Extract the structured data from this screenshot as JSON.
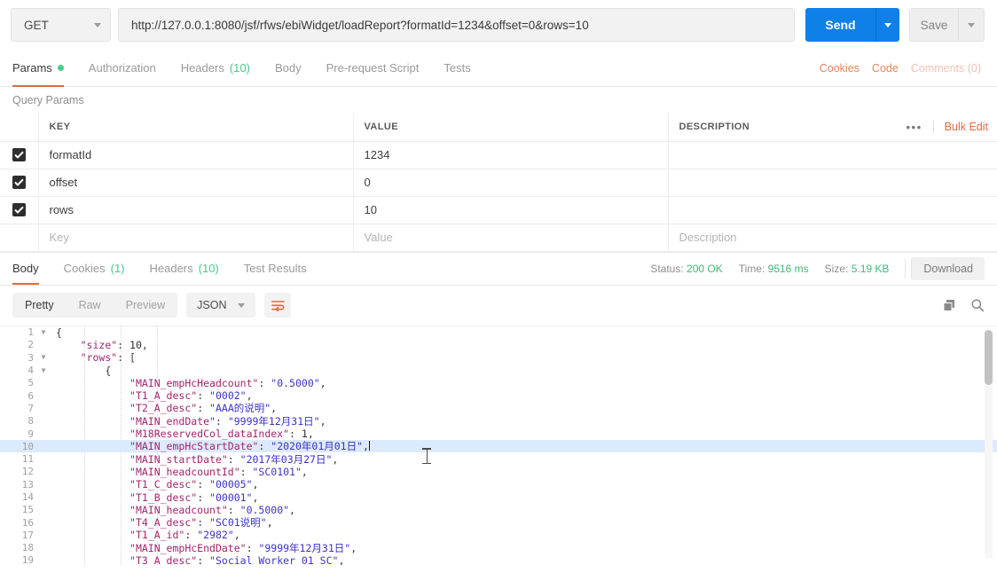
{
  "request_bar": {
    "method": "GET",
    "url": "http://127.0.0.1:8080/jsf/rfws/ebiWidget/loadReport?formatId=1234&offset=0&rows=10",
    "send_label": "Send",
    "save_label": "Save"
  },
  "request_tabs": {
    "items": [
      {
        "label": "Params",
        "active": true,
        "dot": true
      },
      {
        "label": "Authorization",
        "active": false
      },
      {
        "label": "Headers",
        "count": "(10)",
        "active": false
      },
      {
        "label": "Body",
        "active": false
      },
      {
        "label": "Pre-request Script",
        "active": false
      },
      {
        "label": "Tests",
        "active": false
      }
    ],
    "right_links": [
      {
        "label": "Cookies",
        "muted": false
      },
      {
        "label": "Code",
        "muted": false
      },
      {
        "label": "Comments (0)",
        "muted": true
      }
    ]
  },
  "query_params": {
    "section_label": "Query Params",
    "headers": {
      "key": "KEY",
      "value": "VALUE",
      "description": "DESCRIPTION"
    },
    "more_label": "•••",
    "bulk_edit_label": "Bulk Edit",
    "rows": [
      {
        "checked": true,
        "key": "formatId",
        "value": "1234",
        "description": ""
      },
      {
        "checked": true,
        "key": "offset",
        "value": "0",
        "description": ""
      },
      {
        "checked": true,
        "key": "rows",
        "value": "10",
        "description": ""
      }
    ],
    "placeholder_row": {
      "key": "Key",
      "value": "Value",
      "description": "Description"
    }
  },
  "response_tabs": {
    "items": [
      {
        "label": "Body",
        "active": true
      },
      {
        "label": "Cookies",
        "count": "(1)",
        "active": false
      },
      {
        "label": "Headers",
        "count": "(10)",
        "active": false
      },
      {
        "label": "Test Results",
        "active": false
      }
    ],
    "status_label": "Status:",
    "status_value": "200 OK",
    "time_label": "Time:",
    "time_value": "9516 ms",
    "size_label": "Size:",
    "size_value": "5.19 KB",
    "download_label": "Download"
  },
  "body_toolbar": {
    "views": [
      {
        "label": "Pretty",
        "active": true
      },
      {
        "label": "Raw",
        "active": false
      },
      {
        "label": "Preview",
        "active": false
      }
    ],
    "format": "JSON",
    "wrap_icon": "word-wrap-icon",
    "copy_icon": "copy-icon",
    "search_icon": "search-icon"
  },
  "colors": {
    "accent_orange": "#e8673c",
    "send_blue": "#0f80e8",
    "status_green": "#40b877",
    "json_key": "#a3246b",
    "json_string": "#3b33c7",
    "highlight_line": "#dbeafe"
  },
  "response_body": {
    "language": "json",
    "highlighted_line": 10,
    "lines": [
      {
        "n": 1,
        "fold": true,
        "indent": 0,
        "tokens": [
          {
            "t": "{",
            "c": "p"
          }
        ]
      },
      {
        "n": 2,
        "fold": false,
        "indent": 1,
        "tokens": [
          {
            "t": "\"size\"",
            "c": "k"
          },
          {
            "t": ": ",
            "c": "p"
          },
          {
            "t": "10",
            "c": "n"
          },
          {
            "t": ",",
            "c": "p"
          }
        ]
      },
      {
        "n": 3,
        "fold": true,
        "indent": 1,
        "tokens": [
          {
            "t": "\"rows\"",
            "c": "k"
          },
          {
            "t": ": [",
            "c": "p"
          }
        ]
      },
      {
        "n": 4,
        "fold": true,
        "indent": 2,
        "tokens": [
          {
            "t": "{",
            "c": "p"
          }
        ]
      },
      {
        "n": 5,
        "fold": false,
        "indent": 3,
        "tokens": [
          {
            "t": "\"MAIN_empHcHeadcount\"",
            "c": "k"
          },
          {
            "t": ": ",
            "c": "p"
          },
          {
            "t": "\"0.5000\"",
            "c": "s"
          },
          {
            "t": ",",
            "c": "p"
          }
        ]
      },
      {
        "n": 6,
        "fold": false,
        "indent": 3,
        "tokens": [
          {
            "t": "\"T1_A_desc\"",
            "c": "k"
          },
          {
            "t": ": ",
            "c": "p"
          },
          {
            "t": "\"0002\"",
            "c": "s"
          },
          {
            "t": ",",
            "c": "p"
          }
        ]
      },
      {
        "n": 7,
        "fold": false,
        "indent": 3,
        "tokens": [
          {
            "t": "\"T2_A_desc\"",
            "c": "k"
          },
          {
            "t": ": ",
            "c": "p"
          },
          {
            "t": "\"AAA的说明\"",
            "c": "s"
          },
          {
            "t": ",",
            "c": "p"
          }
        ]
      },
      {
        "n": 8,
        "fold": false,
        "indent": 3,
        "tokens": [
          {
            "t": "\"MAIN_endDate\"",
            "c": "k"
          },
          {
            "t": ": ",
            "c": "p"
          },
          {
            "t": "\"9999年12月31日\"",
            "c": "s"
          },
          {
            "t": ",",
            "c": "p"
          }
        ]
      },
      {
        "n": 9,
        "fold": false,
        "indent": 3,
        "tokens": [
          {
            "t": "\"M18ReservedCol_dataIndex\"",
            "c": "k"
          },
          {
            "t": ": ",
            "c": "p"
          },
          {
            "t": "1",
            "c": "n"
          },
          {
            "t": ",",
            "c": "p"
          }
        ]
      },
      {
        "n": 10,
        "fold": false,
        "indent": 3,
        "tokens": [
          {
            "t": "\"MAIN_empHcStartDate\"",
            "c": "k"
          },
          {
            "t": ": ",
            "c": "p"
          },
          {
            "t": "\"2020年01月01日\"",
            "c": "s"
          },
          {
            "t": ",",
            "c": "p"
          }
        ]
      },
      {
        "n": 11,
        "fold": false,
        "indent": 3,
        "tokens": [
          {
            "t": "\"MAIN_startDate\"",
            "c": "k"
          },
          {
            "t": ": ",
            "c": "p"
          },
          {
            "t": "\"2017年03月27日\"",
            "c": "s"
          },
          {
            "t": ",",
            "c": "p"
          }
        ]
      },
      {
        "n": 12,
        "fold": false,
        "indent": 3,
        "tokens": [
          {
            "t": "\"MAIN_headcountId\"",
            "c": "k"
          },
          {
            "t": ": ",
            "c": "p"
          },
          {
            "t": "\"SC0101\"",
            "c": "s"
          },
          {
            "t": ",",
            "c": "p"
          }
        ]
      },
      {
        "n": 13,
        "fold": false,
        "indent": 3,
        "tokens": [
          {
            "t": "\"T1_C_desc\"",
            "c": "k"
          },
          {
            "t": ": ",
            "c": "p"
          },
          {
            "t": "\"00005\"",
            "c": "s"
          },
          {
            "t": ",",
            "c": "p"
          }
        ]
      },
      {
        "n": 14,
        "fold": false,
        "indent": 3,
        "tokens": [
          {
            "t": "\"T1_B_desc\"",
            "c": "k"
          },
          {
            "t": ": ",
            "c": "p"
          },
          {
            "t": "\"00001\"",
            "c": "s"
          },
          {
            "t": ",",
            "c": "p"
          }
        ]
      },
      {
        "n": 15,
        "fold": false,
        "indent": 3,
        "tokens": [
          {
            "t": "\"MAIN_headcount\"",
            "c": "k"
          },
          {
            "t": ": ",
            "c": "p"
          },
          {
            "t": "\"0.5000\"",
            "c": "s"
          },
          {
            "t": ",",
            "c": "p"
          }
        ]
      },
      {
        "n": 16,
        "fold": false,
        "indent": 3,
        "tokens": [
          {
            "t": "\"T4_A_desc\"",
            "c": "k"
          },
          {
            "t": ": ",
            "c": "p"
          },
          {
            "t": "\"SC01说明\"",
            "c": "s"
          },
          {
            "t": ",",
            "c": "p"
          }
        ]
      },
      {
        "n": 17,
        "fold": false,
        "indent": 3,
        "tokens": [
          {
            "t": "\"T1_A_id\"",
            "c": "k"
          },
          {
            "t": ": ",
            "c": "p"
          },
          {
            "t": "\"2982\"",
            "c": "s"
          },
          {
            "t": ",",
            "c": "p"
          }
        ]
      },
      {
        "n": 18,
        "fold": false,
        "indent": 3,
        "tokens": [
          {
            "t": "\"MAIN_empHcEndDate\"",
            "c": "k"
          },
          {
            "t": ": ",
            "c": "p"
          },
          {
            "t": "\"9999年12月31日\"",
            "c": "s"
          },
          {
            "t": ",",
            "c": "p"
          }
        ]
      },
      {
        "n": 19,
        "fold": false,
        "indent": 3,
        "tokens": [
          {
            "t": "\"T3_A_desc\"",
            "c": "k"
          },
          {
            "t": ": ",
            "c": "p"
          },
          {
            "t": "\"Social Worker 01 SC\"",
            "c": "s"
          },
          {
            "t": ",",
            "c": "p"
          }
        ]
      }
    ]
  }
}
